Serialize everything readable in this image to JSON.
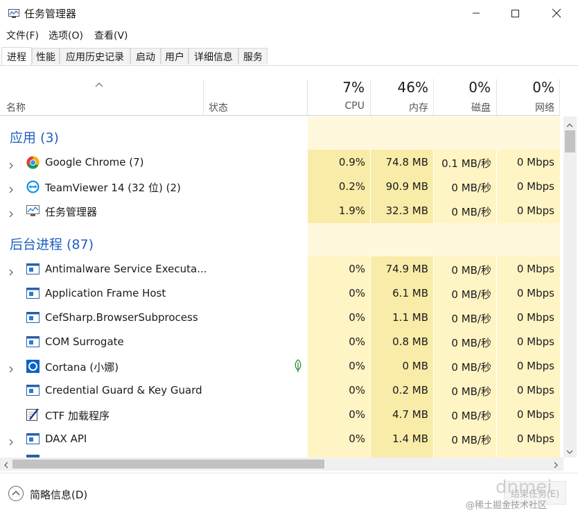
{
  "window": {
    "title": "任务管理器"
  },
  "menu": [
    "文件(F)",
    "选项(O)",
    "查看(V)"
  ],
  "tabs": [
    "进程",
    "性能",
    "应用历史记录",
    "启动",
    "用户",
    "详细信息",
    "服务"
  ],
  "header": {
    "name": "名称",
    "status": "状态",
    "cpu_pct": "7%",
    "cpu": "CPU",
    "mem_pct": "46%",
    "mem": "内存",
    "disk_pct": "0%",
    "disk": "磁盘",
    "net_pct": "0%",
    "net": "网络"
  },
  "groups": {
    "apps_title": "应用 (3)",
    "bg_title": "后台进程 (87)"
  },
  "apps": [
    {
      "name": "Google Chrome (7)",
      "cpu": "0.9%",
      "mem": "74.8 MB",
      "disk": "0.1 MB/秒",
      "net": "0 Mbps"
    },
    {
      "name": "TeamViewer 14 (32 位) (2)",
      "cpu": "0.2%",
      "mem": "90.9 MB",
      "disk": "0 MB/秒",
      "net": "0 Mbps"
    },
    {
      "name": "任务管理器",
      "cpu": "1.9%",
      "mem": "32.3 MB",
      "disk": "0 MB/秒",
      "net": "0 Mbps"
    }
  ],
  "background": [
    {
      "name": "Antimalware Service Executa...",
      "cpu": "0%",
      "mem": "74.9 MB",
      "disk": "0 MB/秒",
      "net": "0 Mbps"
    },
    {
      "name": "Application Frame Host",
      "cpu": "0%",
      "mem": "6.1 MB",
      "disk": "0 MB/秒",
      "net": "0 Mbps"
    },
    {
      "name": "CefSharp.BrowserSubprocess",
      "cpu": "0%",
      "mem": "1.1 MB",
      "disk": "0 MB/秒",
      "net": "0 Mbps"
    },
    {
      "name": "COM Surrogate",
      "cpu": "0%",
      "mem": "0.8 MB",
      "disk": "0 MB/秒",
      "net": "0 Mbps"
    },
    {
      "name": "Cortana (小娜)",
      "cpu": "0%",
      "mem": "0 MB",
      "disk": "0 MB/秒",
      "net": "0 Mbps"
    },
    {
      "name": "Credential Guard & Key Guard",
      "cpu": "0%",
      "mem": "0.2 MB",
      "disk": "0 MB/秒",
      "net": "0 Mbps"
    },
    {
      "name": "CTF 加载程序",
      "cpu": "0%",
      "mem": "4.7 MB",
      "disk": "0 MB/秒",
      "net": "0 Mbps"
    },
    {
      "name": "DAX API",
      "cpu": "0%",
      "mem": "1.4 MB",
      "disk": "0 MB/秒",
      "net": "0 Mbps"
    }
  ],
  "footer": {
    "brief_label": "简略信息(D)",
    "end_task": "结束任务(E)"
  },
  "watermark": {
    "logo": "dnmei",
    "credit": "@稀土掘金技术社区"
  },
  "colors": {
    "accent": "#1f5fbf",
    "cell_light": "#fff4c4",
    "cell_mid": "#f9eca8"
  }
}
